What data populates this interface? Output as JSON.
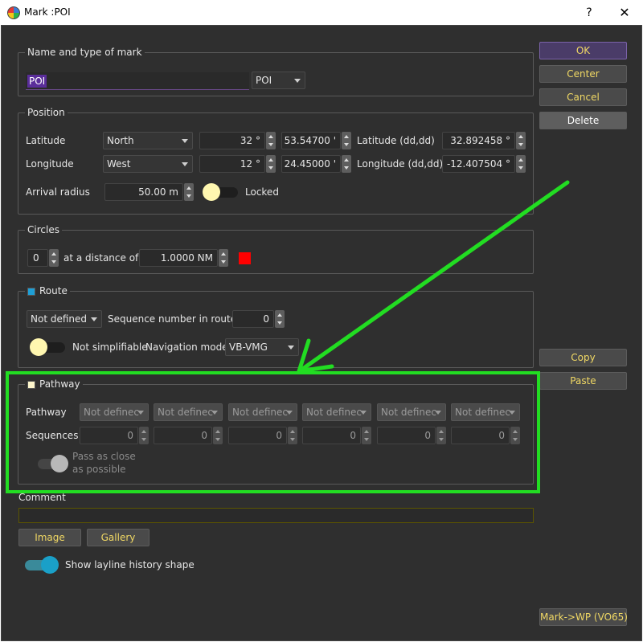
{
  "window": {
    "title": "Mark :POI",
    "help": "?",
    "close": "✕"
  },
  "colors": {
    "accent_green": "#22dd22",
    "circle_color": "#ff0000"
  },
  "name_group": {
    "title": "Name and type of mark",
    "name_value": "POI",
    "type_value": "POI"
  },
  "position": {
    "title": "Position",
    "lat_label": "Latitude",
    "lat_hemi": "North",
    "lat_deg": "32 °",
    "lat_min": "53.54700 '",
    "lat_dd_label": "Latitude (dd,dd)",
    "lat_dd": "32.892458 °",
    "lon_label": "Longitude",
    "lon_hemi": "West",
    "lon_deg": "12 °",
    "lon_min": "24.45000 '",
    "lon_dd_label": "Longitude (dd,dd)",
    "lon_dd": "-12.407504 °",
    "radius_label": "Arrival radius",
    "radius_value": "50.00 m",
    "locked_label": "Locked"
  },
  "circles": {
    "title": "Circles",
    "count": "0",
    "distance_label": "at a distance of",
    "distance_value": "1.0000 NM"
  },
  "route": {
    "title": "Route",
    "definition": "Not defined",
    "seq_label": "Sequence number in route",
    "seq_value": "0",
    "simplify_label": "Not simplifiable",
    "nav_mode_label": "Navigation mode",
    "nav_mode_value": "VB-VMG"
  },
  "pathway": {
    "title": "Pathway",
    "row_label": "Pathway",
    "seq_label": "Sequences",
    "combos": [
      "Not definec",
      "Not definec",
      "Not definec",
      "Not definec",
      "Not definec",
      "Not definec"
    ],
    "sequences": [
      "0",
      "0",
      "0",
      "0",
      "0",
      "0"
    ],
    "pass_close_line1": "Pass as close",
    "pass_close_line2": "as possible"
  },
  "comment": {
    "label": "Comment"
  },
  "buttons": {
    "ok": "OK",
    "center": "Center",
    "cancel": "Cancel",
    "delete": "Delete",
    "copy": "Copy",
    "paste": "Paste",
    "image": "Image",
    "gallery": "Gallery",
    "mark_wp": "Mark->WP (VO65)"
  },
  "layline": {
    "label": "Show layline history shape"
  }
}
